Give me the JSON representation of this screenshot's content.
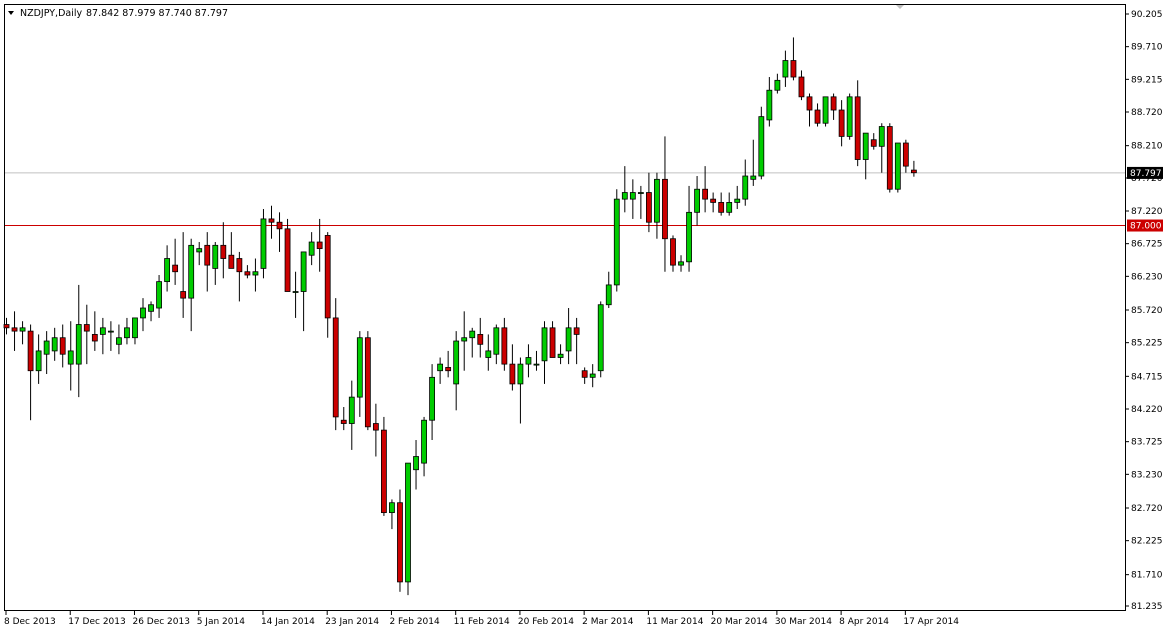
{
  "header": {
    "symbol": "NZDJPY,Daily",
    "ohlc": "87.842 87.979 87.740 87.797"
  },
  "colors": {
    "bull": "#00cc00",
    "bear": "#cc0000",
    "wick": "#000000",
    "level_line": "#cc0000",
    "price_line": "#c0c0c0"
  },
  "chart_data": {
    "type": "candlestick",
    "title": "",
    "y_ticks": [
      "90.205",
      "89.710",
      "89.215",
      "88.720",
      "88.210",
      "87.720",
      "87.220",
      "86.725",
      "86.230",
      "85.720",
      "85.225",
      "84.715",
      "84.220",
      "83.725",
      "83.230",
      "82.720",
      "82.225",
      "81.710",
      "81.235"
    ],
    "ylim": [
      81.235,
      90.205
    ],
    "x_labels": [
      "8 Dec 2013",
      "17 Dec 2013",
      "26 Dec 2013",
      "5 Jan 2014",
      "14 Jan 2014",
      "23 Jan 2014",
      "2 Feb 2014",
      "11 Feb 2014",
      "20 Feb 2014",
      "2 Mar 2014",
      "11 Mar 2014",
      "20 Mar 2014",
      "30 Mar 2014",
      "8 Apr 2014",
      "17 Apr 2014"
    ],
    "x_label_index": [
      0,
      8,
      16,
      24,
      32,
      40,
      48,
      56,
      64,
      72,
      80,
      88,
      96,
      104,
      112
    ],
    "current_price": {
      "label": "87.797",
      "value": 87.797
    },
    "horizontal_level": {
      "label": "87.000",
      "value": 87.0
    },
    "candles": [
      [
        85.5,
        85.6,
        85.35,
        85.45
      ],
      [
        85.45,
        85.7,
        85.1,
        85.4
      ],
      [
        85.4,
        85.55,
        85.2,
        85.45
      ],
      [
        85.4,
        85.5,
        84.05,
        84.8
      ],
      [
        84.8,
        85.35,
        84.6,
        85.1
      ],
      [
        85.05,
        85.4,
        84.75,
        85.25
      ],
      [
        85.1,
        85.45,
        84.95,
        85.3
      ],
      [
        85.3,
        85.5,
        84.85,
        85.05
      ],
      [
        84.9,
        85.55,
        84.5,
        85.1
      ],
      [
        84.9,
        86.1,
        84.4,
        85.5
      ],
      [
        85.5,
        85.8,
        84.9,
        85.4
      ],
      [
        85.35,
        85.7,
        85.1,
        85.25
      ],
      [
        85.35,
        85.6,
        85.05,
        85.45
      ],
      [
        85.4,
        85.55,
        85.1,
        85.4
      ],
      [
        85.2,
        85.5,
        85.05,
        85.3
      ],
      [
        85.3,
        85.6,
        85.2,
        85.45
      ],
      [
        85.3,
        85.55,
        85.2,
        85.6
      ],
      [
        85.6,
        85.9,
        85.4,
        85.75
      ],
      [
        85.7,
        85.85,
        85.55,
        85.8
      ],
      [
        85.75,
        86.25,
        85.6,
        86.15
      ],
      [
        86.15,
        86.7,
        86.0,
        86.5
      ],
      [
        86.4,
        86.8,
        86.1,
        86.3
      ],
      [
        86.0,
        86.9,
        85.6,
        85.9
      ],
      [
        85.9,
        86.8,
        85.4,
        86.7
      ],
      [
        86.6,
        86.75,
        86.4,
        86.65
      ],
      [
        86.7,
        86.9,
        86.0,
        86.4
      ],
      [
        86.35,
        86.75,
        86.1,
        86.7
      ],
      [
        86.7,
        87.05,
        86.2,
        86.5
      ],
      [
        86.55,
        86.9,
        86.4,
        86.35
      ],
      [
        86.5,
        86.6,
        85.85,
        86.3
      ],
      [
        86.3,
        86.4,
        86.2,
        86.25
      ],
      [
        86.25,
        86.5,
        86.0,
        86.3
      ],
      [
        86.35,
        87.25,
        86.2,
        87.1
      ],
      [
        87.1,
        87.3,
        86.8,
        87.05
      ],
      [
        87.05,
        87.2,
        86.6,
        86.95
      ],
      [
        86.95,
        87.1,
        86.0,
        86.0
      ],
      [
        86.0,
        86.3,
        85.6,
        86.0
      ],
      [
        86.0,
        86.6,
        85.4,
        86.6
      ],
      [
        86.55,
        86.9,
        86.4,
        86.75
      ],
      [
        86.75,
        87.1,
        86.3,
        86.65
      ],
      [
        86.85,
        86.9,
        85.3,
        85.6
      ],
      [
        85.6,
        85.9,
        83.9,
        84.1
      ],
      [
        84.05,
        84.25,
        83.9,
        84.0
      ],
      [
        84.0,
        84.65,
        83.6,
        84.4
      ],
      [
        84.4,
        85.4,
        84.1,
        85.3
      ],
      [
        85.3,
        85.4,
        83.9,
        83.95
      ],
      [
        84.0,
        84.3,
        83.5,
        83.9
      ],
      [
        83.9,
        84.1,
        82.6,
        82.65
      ],
      [
        82.65,
        82.85,
        82.4,
        82.8
      ],
      [
        82.8,
        83.0,
        81.45,
        81.6
      ],
      [
        81.6,
        83.4,
        81.4,
        83.4
      ],
      [
        83.3,
        83.75,
        83.0,
        83.5
      ],
      [
        83.4,
        84.1,
        83.2,
        84.05
      ],
      [
        84.05,
        84.9,
        83.75,
        84.7
      ],
      [
        84.8,
        85.0,
        84.6,
        84.9
      ],
      [
        84.85,
        85.1,
        84.7,
        84.8
      ],
      [
        84.6,
        85.4,
        84.2,
        85.25
      ],
      [
        85.25,
        85.7,
        84.8,
        85.3
      ],
      [
        85.3,
        85.45,
        85.0,
        85.4
      ],
      [
        85.35,
        85.6,
        85.0,
        85.2
      ],
      [
        85.0,
        85.35,
        84.8,
        85.1
      ],
      [
        85.05,
        85.5,
        84.9,
        85.45
      ],
      [
        85.45,
        85.6,
        84.8,
        84.9
      ],
      [
        84.9,
        85.2,
        84.5,
        84.6
      ],
      [
        84.6,
        85.0,
        84.0,
        84.9
      ],
      [
        84.9,
        85.2,
        84.7,
        85.0
      ],
      [
        84.9,
        85.1,
        84.8,
        84.9
      ],
      [
        84.95,
        85.55,
        84.6,
        85.45
      ],
      [
        85.45,
        85.55,
        85.0,
        85.0
      ],
      [
        85.0,
        85.2,
        84.9,
        85.05
      ],
      [
        85.1,
        85.75,
        84.9,
        85.45
      ],
      [
        85.45,
        85.6,
        84.9,
        85.35
      ],
      [
        84.8,
        84.85,
        84.6,
        84.7
      ],
      [
        84.7,
        84.9,
        84.55,
        84.75
      ],
      [
        84.8,
        85.85,
        84.7,
        85.8
      ],
      [
        85.8,
        86.3,
        85.75,
        86.1
      ],
      [
        86.1,
        87.55,
        86.0,
        87.4
      ],
      [
        87.4,
        87.9,
        87.2,
        87.5
      ],
      [
        87.4,
        87.7,
        87.1,
        87.5
      ],
      [
        87.5,
        87.6,
        87.1,
        87.5
      ],
      [
        87.5,
        87.8,
        86.9,
        87.05
      ],
      [
        87.05,
        87.8,
        86.8,
        87.7
      ],
      [
        87.7,
        88.35,
        86.3,
        86.8
      ],
      [
        86.8,
        86.85,
        86.3,
        86.4
      ],
      [
        86.4,
        86.55,
        86.3,
        86.45
      ],
      [
        86.45,
        87.6,
        86.3,
        87.2
      ],
      [
        87.2,
        87.75,
        87.0,
        87.55
      ],
      [
        87.55,
        87.9,
        87.2,
        87.4
      ],
      [
        87.4,
        87.5,
        87.2,
        87.35
      ],
      [
        87.35,
        87.5,
        87.15,
        87.2
      ],
      [
        87.2,
        87.5,
        87.15,
        87.35
      ],
      [
        87.35,
        87.6,
        87.25,
        87.4
      ],
      [
        87.4,
        88.0,
        87.3,
        87.75
      ],
      [
        87.7,
        88.3,
        87.6,
        87.75
      ],
      [
        87.75,
        88.8,
        87.7,
        88.65
      ],
      [
        88.6,
        89.25,
        88.5,
        89.05
      ],
      [
        89.05,
        89.3,
        89.0,
        89.2
      ],
      [
        89.25,
        89.65,
        89.1,
        89.5
      ],
      [
        89.5,
        89.85,
        89.2,
        89.25
      ],
      [
        89.25,
        89.35,
        88.9,
        88.95
      ],
      [
        88.95,
        89.0,
        88.5,
        88.75
      ],
      [
        88.75,
        88.85,
        88.5,
        88.55
      ],
      [
        88.55,
        88.95,
        88.5,
        88.95
      ],
      [
        88.95,
        89.0,
        88.6,
        88.75
      ],
      [
        88.75,
        88.9,
        88.2,
        88.35
      ],
      [
        88.35,
        89.0,
        88.3,
        88.95
      ],
      [
        88.95,
        89.2,
        87.9,
        88.0
      ],
      [
        88.0,
        88.4,
        87.7,
        88.4
      ],
      [
        88.3,
        88.4,
        88.15,
        88.2
      ],
      [
        88.2,
        88.55,
        87.8,
        88.5
      ],
      [
        88.5,
        88.55,
        87.5,
        87.55
      ],
      [
        87.55,
        88.25,
        87.5,
        88.25
      ],
      [
        88.25,
        88.3,
        87.8,
        87.9
      ],
      [
        87.84,
        87.98,
        87.74,
        87.8
      ]
    ]
  }
}
